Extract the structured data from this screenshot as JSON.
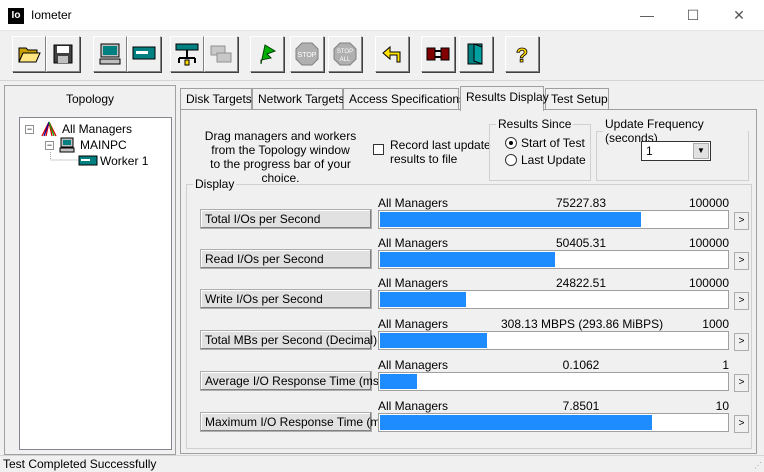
{
  "window": {
    "icon_text": "Io",
    "title": "Iometer",
    "min_glyph": "—",
    "max_glyph": "☐",
    "close_glyph": "✕"
  },
  "toolbar": {
    "buttons": [
      {
        "name": "open-config-button",
        "icon": "open-folder-icon"
      },
      {
        "name": "save-config-button",
        "icon": "floppy-disk-icon"
      },
      {
        "name": "new-manager-button",
        "icon": "computer-icon"
      },
      {
        "name": "new-worker-button",
        "icon": "disk-worker-icon"
      },
      {
        "name": "new-network-worker-button",
        "icon": "network-worker-icon"
      },
      {
        "name": "duplicate-worker-button",
        "icon": "duplicate-icon"
      },
      {
        "name": "start-tests-button",
        "icon": "green-flag-icon"
      },
      {
        "name": "stop-button",
        "icon": "stop-icon",
        "label": "STOP"
      },
      {
        "name": "stop-all-button",
        "icon": "stop-all-icon",
        "label_top": "STOP",
        "label_bottom": "ALL"
      },
      {
        "name": "reset-workers-button",
        "icon": "reset-arrow-icon"
      },
      {
        "name": "disconnect-button",
        "icon": "disconnect-icon"
      },
      {
        "name": "exit-button",
        "icon": "exit-door-icon"
      },
      {
        "name": "about-button",
        "icon": "help-question-icon",
        "label": "?"
      }
    ]
  },
  "topology": {
    "title": "Topology",
    "nodes": [
      {
        "label": "All Managers",
        "icon": "all-managers-icon",
        "expander": "−"
      },
      {
        "label": "MAINPC",
        "icon": "computer-icon",
        "expander": "−"
      },
      {
        "label": "Worker 1",
        "icon": "worker-icon"
      }
    ]
  },
  "tabs": [
    {
      "label": "Disk Targets"
    },
    {
      "label": "Network Targets"
    },
    {
      "label": "Access Specifications"
    },
    {
      "label": "Results Display",
      "active": true
    },
    {
      "label": "Test Setup"
    }
  ],
  "results": {
    "instructions_line1": "Drag managers and workers",
    "instructions_line2": "from the Topology window",
    "instructions_line3": "to the progress bar of your choice.",
    "record_label_line1": "Record last update",
    "record_label_line2": "results to file",
    "record_checked": false,
    "results_since": {
      "legend": "Results Since",
      "options": [
        "Start of Test",
        "Last Update"
      ],
      "selected": "Start of Test"
    },
    "update_frequency": {
      "legend": "Update Frequency (seconds)",
      "value": "1",
      "arrow": "▼"
    },
    "display_legend": "Display",
    "row_arrow": ">",
    "rows": [
      {
        "label": "Total I/Os per Second",
        "manager": "All Managers",
        "value": "75227.83",
        "max": "100000",
        "fraction": 0.752
      },
      {
        "label": "Read I/Os per Second",
        "manager": "All Managers",
        "value": "50405.31",
        "max": "100000",
        "fraction": 0.504
      },
      {
        "label": "Write I/Os per Second",
        "manager": "All Managers",
        "value": "24822.51",
        "max": "100000",
        "fraction": 0.248
      },
      {
        "label": "Total MBs per Second (Decimal)",
        "manager": "All Managers",
        "value": "308.13 MBPS (293.86 MiBPS)",
        "max": "1000",
        "fraction": 0.308
      },
      {
        "label": "Average I/O Response Time (ms)",
        "manager": "All Managers",
        "value": "0.1062",
        "max": "1",
        "fraction": 0.106
      },
      {
        "label": "Maximum I/O Response Time (ms)",
        "manager": "All Managers",
        "value": "7.8501",
        "max": "10",
        "fraction": 0.785
      }
    ]
  },
  "status": {
    "text": "Test Completed Successfully",
    "grip": "⋰"
  }
}
